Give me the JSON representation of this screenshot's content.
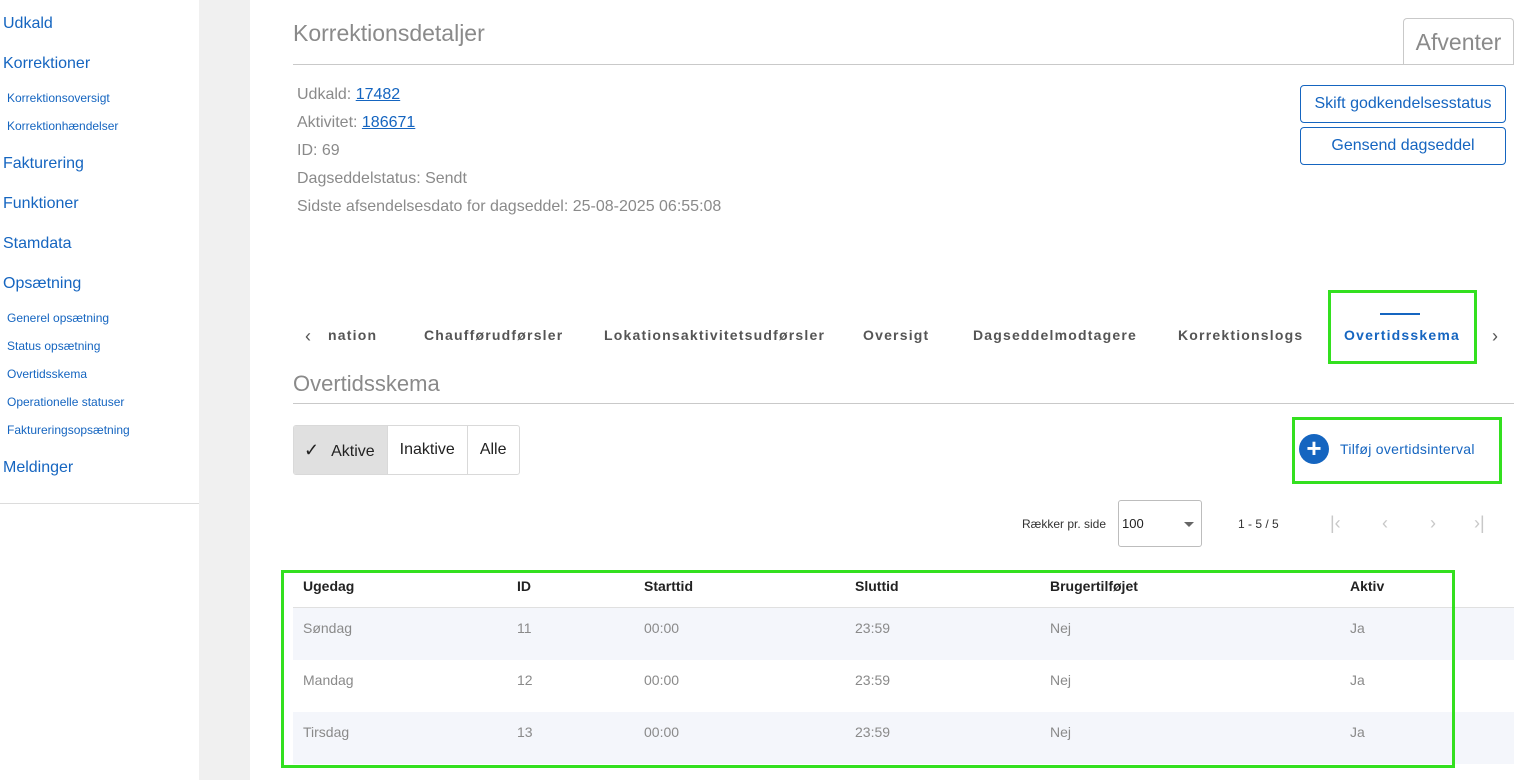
{
  "sidebar": {
    "udkald": "Udkald",
    "korrektioner": "Korrektioner",
    "korrektionsoversigt": "Korrektionsoversigt",
    "korrektionhaendelser": "Korrektionhændelser",
    "fakturering": "Fakturering",
    "funktioner": "Funktioner",
    "stamdata": "Stamdata",
    "opsaetning": "Opsætning",
    "generel_opsaetning": "Generel opsætning",
    "status_opsaetning": "Status opsætning",
    "overtidsskema": "Overtidsskema",
    "operationelle_statuser": "Operationelle statuser",
    "faktureringsopsaetning": "Faktureringsopsætning",
    "meldinger": "Meldinger"
  },
  "header": {
    "title": "Korrektionsdetaljer",
    "status": "Afventer"
  },
  "info": {
    "udkald_label": "Udkald: ",
    "udkald_value": "17482",
    "aktivitet_label": "Aktivitet: ",
    "aktivitet_value": "186671",
    "id": "ID: 69",
    "dagseddelstatus": "Dagseddelstatus: Sendt",
    "afsendelsesdato": "Sidste afsendelsesdato for dagseddel: 25-08-2025 06:55:08"
  },
  "actions": {
    "skift": "Skift godkendelsesstatus",
    "gensend": "Gensend dagseddel"
  },
  "tabs": {
    "prev": "‹",
    "next": "›",
    "t0": "nation",
    "t1": "Chaufførudførsler",
    "t2": "Lokationsaktivitetsudførsler",
    "t3": "Oversigt",
    "t4": "Dagseddelmodtagere",
    "t5": "Korrektionslogs",
    "t6": "Overtidsskema"
  },
  "section": {
    "title": "Overtidsskema",
    "filter_check": "✓",
    "filter_aktive": "Aktive",
    "filter_inaktive": "Inaktive",
    "filter_alle": "Alle",
    "add_label": "Tilføj overtidsinterval",
    "add_icon": "+"
  },
  "pagination": {
    "rows_label": "Rækker pr. side",
    "rows_value": "100",
    "range": "1 - 5 / 5",
    "first": "|‹",
    "prev": "‹",
    "next": "›",
    "last": "›|"
  },
  "table": {
    "headers": [
      "Ugedag",
      "ID",
      "Starttid",
      "Sluttid",
      "Brugertilføjet",
      "Aktiv"
    ],
    "rows": [
      [
        "Søndag",
        "11",
        "00:00",
        "23:59",
        "Nej",
        "Ja"
      ],
      [
        "Mandag",
        "12",
        "00:00",
        "23:59",
        "Nej",
        "Ja"
      ],
      [
        "Tirsdag",
        "13",
        "00:00",
        "23:59",
        "Nej",
        "Ja"
      ]
    ]
  },
  "colors": {
    "link": "#1565c0",
    "highlight": "#33e01f",
    "muted_text": "#8a8a8a"
  }
}
